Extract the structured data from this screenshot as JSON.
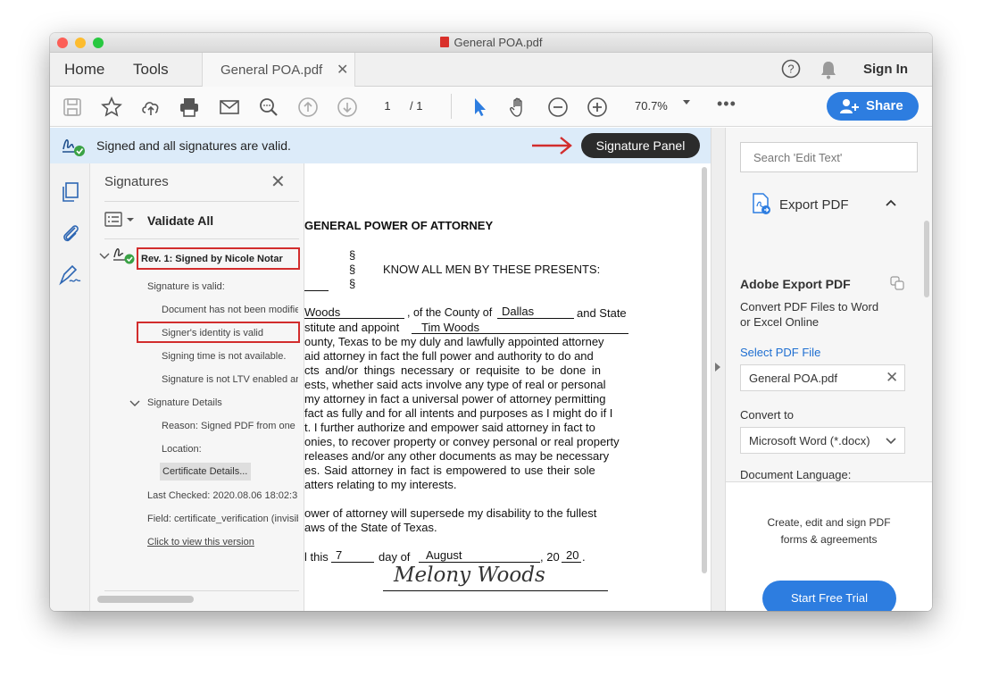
{
  "window": {
    "title": "General POA.pdf"
  },
  "menu": {
    "home": "Home",
    "tools": "Tools",
    "tab_label": "General POA.pdf",
    "tab_close": "✕",
    "sign_in": "Sign In"
  },
  "toolbar": {
    "page_current": "1",
    "page_total": "/ 1",
    "zoom": "70.7%",
    "more": "•••",
    "share": "Share"
  },
  "notice": {
    "text": "Signed and all signatures are valid.",
    "callout": "Signature Panel"
  },
  "signatures": {
    "title": "Signatures",
    "close": "✕",
    "validate_all": "Validate All",
    "revision": "Rev. 1: Signed by Nicole Notar",
    "items": [
      "Signature is valid:",
      "Document has not been modified",
      "Signer's identity is valid",
      "Signing time is not available.",
      "Signature is not LTV enabled and will expire",
      "Signature Details",
      "Reason: Signed PDF from one",
      "Location:",
      "Certificate Details...",
      "Last Checked: 2020.08.06 18:02:3",
      "Field: certificate_verification (invisible)",
      "Click to view this version"
    ]
  },
  "document": {
    "heading": "GENERAL POWER OF ATTORNEY",
    "section_marks": [
      "§",
      "§",
      "§"
    ],
    "know_all": "KNOW ALL MEN BY THESE PRESENTS:",
    "lines": [
      "Woods",
      ", of the County of",
      "Dallas",
      "and State",
      "stitute and appoint",
      "Tim Woods",
      "ounty, Texas to be my duly and lawfully appointed attorney",
      "aid attorney in fact the full power and authority to do and",
      "cts and/or things necessary or requisite to be done in",
      "ests, whether said acts involve any type of real or personal",
      "my attorney in fact a universal power of attorney permitting",
      "fact as fully and for all intents and purposes as I might do if I",
      "t.  I further authorize and empower said attorney in fact to",
      "onies, to recover property or convey personal or real property",
      "releases and/or any other documents as may be necessary",
      "es.  Said attorney in fact is empowered to use their sole",
      "atters relating to my interests.",
      "ower of attorney will supersede my disability to the fullest",
      "aws of the State of Texas."
    ],
    "date_prefix": "l this",
    "date_day": "7",
    "date_mid": "day of",
    "date_month": "August",
    "date_year_prefix": ", 20",
    "date_year": "20",
    "date_end": ".",
    "signature": "Melony Woods"
  },
  "right_panel": {
    "search_placeholder": "Search 'Edit Text'",
    "export_title": "Export PDF",
    "adobe_export": "Adobe Export PDF",
    "convert_desc_1": "Convert PDF Files to Word",
    "convert_desc_2": "or Excel Online",
    "select_pdf": "Select PDF File",
    "file_name": "General POA.pdf",
    "convert_to": "Convert to",
    "format": "Microsoft Word (*.docx)",
    "doc_language": "Document Language:",
    "promo_1": "Create, edit and sign PDF",
    "promo_2": "forms & agreements",
    "trial": "Start Free Trial"
  },
  "colors": {
    "accent": "#2d7de0",
    "callout": "#2b2b2b",
    "highlight_box": "#d22d2d",
    "valid_check": "#3aa245",
    "notice_bg": "#dcebf9"
  }
}
